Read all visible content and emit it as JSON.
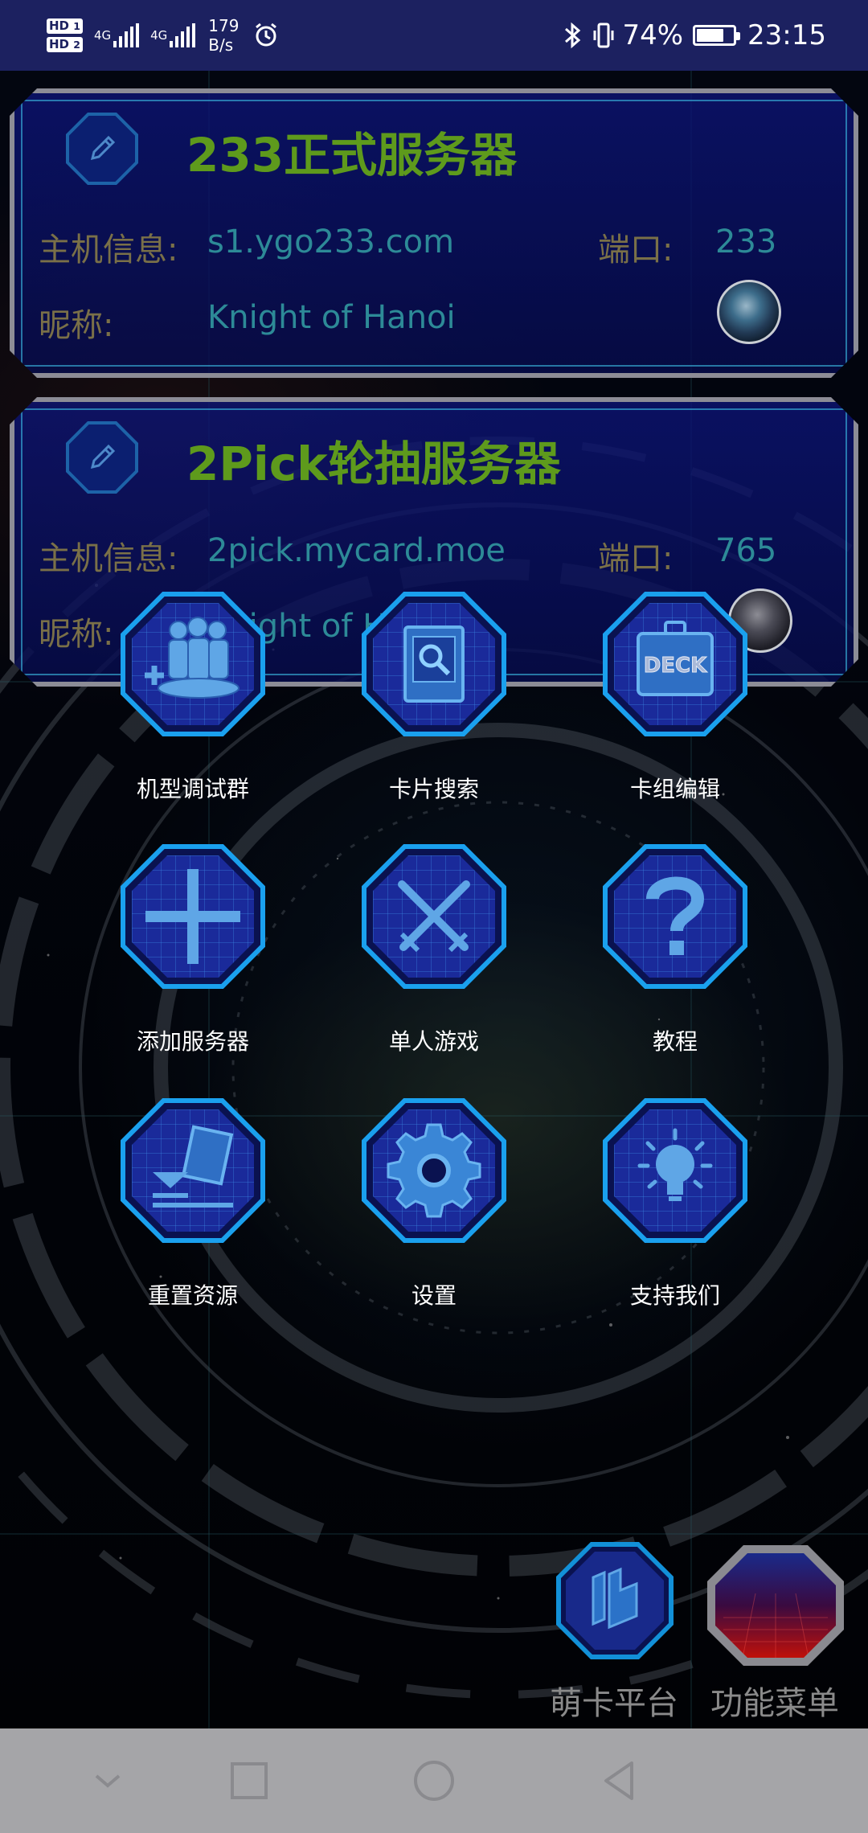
{
  "status_bar": {
    "hd1": "HD",
    "hd1_sub": "1",
    "hd2": "HD",
    "hd2_sub": "2",
    "signal1_label": "4G",
    "signal2_label": "4G",
    "speed_value": "179",
    "speed_unit": "B/s",
    "battery_text": "74%",
    "battery_level": 0.74,
    "time": "23:15",
    "icons": [
      "alarm-icon",
      "bluetooth-icon",
      "vibrate-icon",
      "battery-icon"
    ]
  },
  "servers": [
    {
      "title": "233正式服务器",
      "host_label": "主机信息:",
      "host": "s1.ygo233.com",
      "port_label": "端口:",
      "port": "233",
      "nick_label": "昵称:",
      "nick": "Knight of Hanoi"
    },
    {
      "title": "2Pick轮抽服务器",
      "host_label": "主机信息:",
      "host": "2pick.mycard.moe",
      "port_label": "端口:",
      "port": "765",
      "nick_label": "昵称:",
      "nick": "Knight of Hanoi"
    }
  ],
  "menu": [
    {
      "label": "机型调试群",
      "icon": "group-add-icon"
    },
    {
      "label": "卡片搜索",
      "icon": "card-search-icon"
    },
    {
      "label": "卡组编辑",
      "icon": "deck-icon"
    },
    {
      "label": "添加服务器",
      "icon": "plus-icon"
    },
    {
      "label": "单人游戏",
      "icon": "crossed-swords-icon"
    },
    {
      "label": "教程",
      "icon": "question-icon"
    },
    {
      "label": "重置资源",
      "icon": "reset-resource-icon"
    },
    {
      "label": "设置",
      "icon": "gear-icon"
    },
    {
      "label": "支持我们",
      "icon": "lightbulb-icon"
    }
  ],
  "deck_text": "DECK",
  "bottom": {
    "platform_label": "萌卡平台",
    "menu_label": "功能菜单"
  },
  "colors": {
    "status_bar": "#1c2160",
    "server_title": "#5e9a1c",
    "info_label": "#7a7048",
    "info_value": "#2d8a97",
    "menu_accent": "#1aa0ee",
    "nav_bar": "#a5a5a8"
  },
  "navbar": {
    "icons": [
      "nav-down-icon",
      "nav-recent-icon",
      "nav-home-icon",
      "nav-back-icon"
    ]
  }
}
